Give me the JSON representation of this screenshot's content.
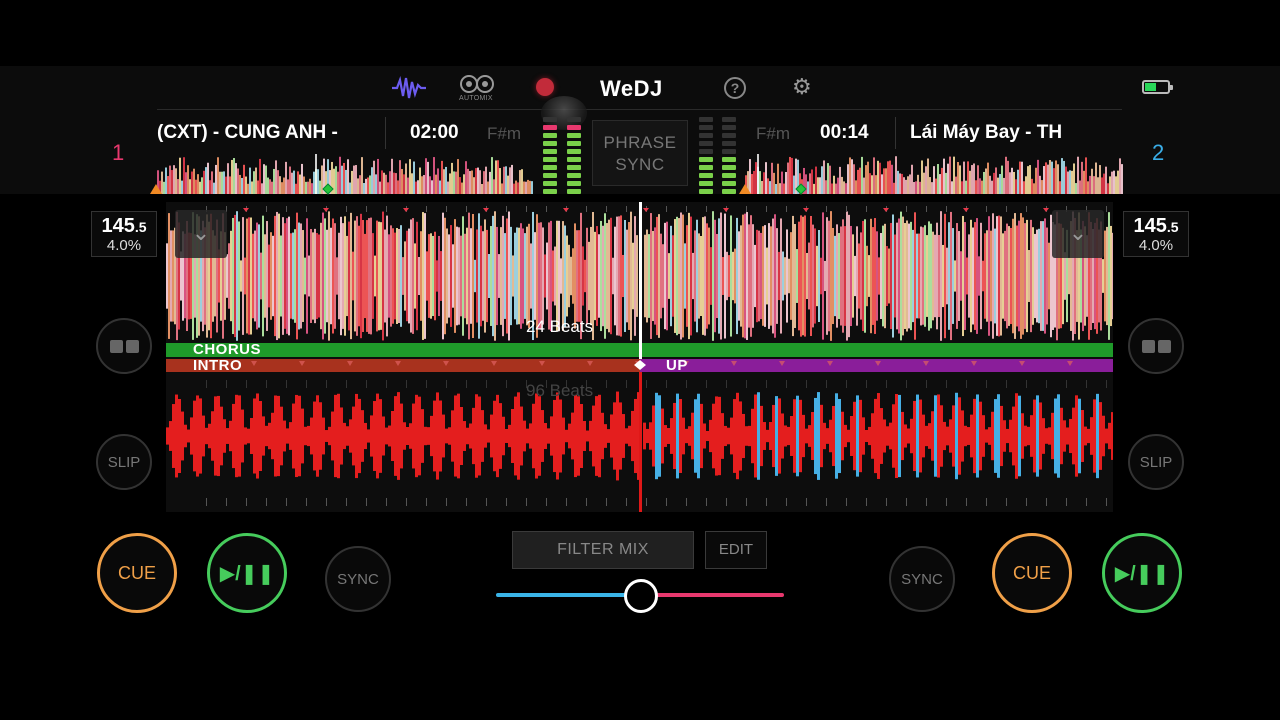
{
  "app": {
    "title": "WeDJ"
  },
  "header": {
    "automix_label": "AUTOMIX",
    "help_icon": "?",
    "settings_icon": "⚙"
  },
  "colors": {
    "deck_a": "#e8386e",
    "deck_b": "#3aaee8",
    "cue": "#f0a048",
    "play": "#46cc5c"
  },
  "deck_a": {
    "number": "1",
    "title": "(CXT) - CUNG ANH -",
    "time": "02:00",
    "key": "F#m",
    "bpm_main": "145",
    "bpm_decimal": ".5",
    "pitch": "4.0%",
    "slip_label": "SLIP",
    "cue_label": "CUE",
    "play_label": "▶/❚❚",
    "sync_label": "SYNC"
  },
  "deck_b": {
    "number": "2",
    "title": "Lái Máy Bay - TH",
    "time": "00:14",
    "key": "F#m",
    "bpm_main": "145",
    "bpm_decimal": ".5",
    "pitch": "4.0%",
    "slip_label": "SLIP",
    "cue_label": "CUE",
    "play_label": "▶/❚❚",
    "sync_label": "SYNC"
  },
  "center": {
    "phrase_sync_line1": "PHRASE",
    "phrase_sync_line2": "SYNC",
    "filter_mix_label": "FILTER MIX",
    "edit_label": "EDIT"
  },
  "waveform": {
    "upper_beats_label": "24 Beats",
    "lower_beats_label": "96 Beats",
    "phrase_upper": "CHORUS",
    "phrase_lower_left": "INTRO",
    "phrase_lower_right": "UP"
  }
}
